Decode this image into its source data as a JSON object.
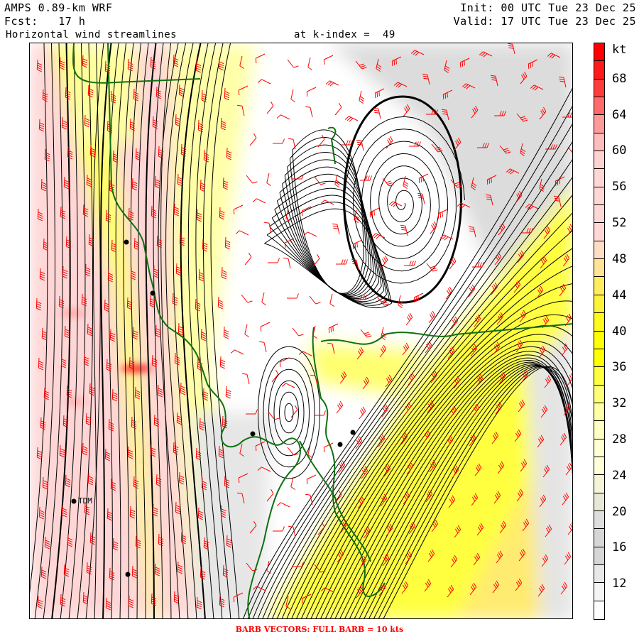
{
  "header": {
    "model": "AMPS 0.89-km WRF",
    "forecast": "Fcst:   17 h",
    "init": "Init: 00 UTC Tue 23 Dec 25",
    "valid": "Valid: 17 UTC Tue 23 Dec 25",
    "field": "Horizontal wind streamlines",
    "level": "at k-index =  49"
  },
  "colorbar": {
    "units": "kt",
    "labels": [
      "68",
      "64",
      "60",
      "56",
      "52",
      "48",
      "44",
      "40",
      "36",
      "32",
      "28",
      "24",
      "20",
      "16",
      "12"
    ],
    "colors": [
      "#ff0000",
      "#ff1a1a",
      "#ff3c3c",
      "#ff6a6a",
      "#ff9a9a",
      "#ffbcbc",
      "#ffd2d2",
      "#ffd6d6",
      "#ffd6d6",
      "#ffd6d6",
      "#ffd6d6",
      "#ffdcc4",
      "#ffe396",
      "#ffec5e",
      "#fff33a",
      "#fffa1c",
      "#ffff00",
      "#ffff00",
      "#ffff40",
      "#ffff78",
      "#ffffa8",
      "#ffffc4",
      "#ffffd2",
      "#ffffda",
      "#f4f4d8",
      "#e8e8d6",
      "#dedede",
      "#d6d6d6",
      "#d6d6d6",
      "#e8e8e8",
      "#f4f4f4",
      "#ffffff"
    ]
  },
  "stations": [
    {
      "label": "TDM"
    }
  ],
  "caption": "BARB VECTORS:  FULL BARB = 10 kts",
  "colors": {
    "streamline": "#000000",
    "coastline": "#107010",
    "barb": "#ff0000"
  }
}
